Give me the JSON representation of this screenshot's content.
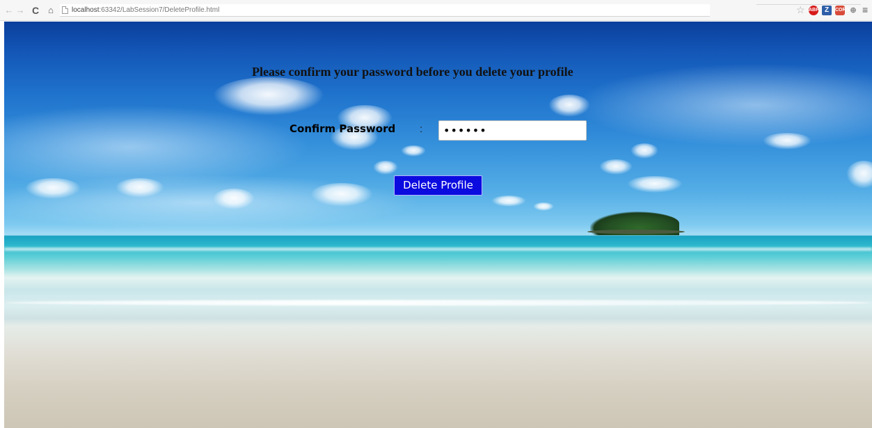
{
  "browser": {
    "back_glyph": "←",
    "forward_glyph": "→",
    "reload_glyph": "C",
    "home_glyph": "⌂",
    "url_host": "localhost",
    "url_rest": ":63342/LabSession7/DeleteProfile.html",
    "star_glyph": "☆",
    "menu_glyph": "≡",
    "extensions": {
      "abp": "ABP",
      "z": "Z",
      "red": "CORS",
      "puzzle": "⊕"
    }
  },
  "form": {
    "heading": "Please confirm your password before you delete your profile",
    "password_label": "Confirm Password",
    "colon": ":",
    "password_value": "123456",
    "delete_label": "Delete Profile"
  },
  "colors": {
    "button_bg": "#0b0be0",
    "button_text": "#ffffff",
    "heading_text": "#111111"
  }
}
